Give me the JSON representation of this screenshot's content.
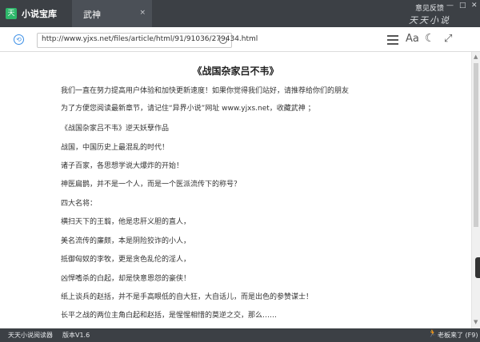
{
  "app": {
    "logo": "天",
    "title": "小说宝库",
    "tab_label": "武神",
    "tab_close": "×",
    "feedback": "意见反馈",
    "brand": "天天小说",
    "minimize": "—",
    "maximize": "□",
    "close": "✕"
  },
  "toolbar": {
    "back_icon": "⟲",
    "url": "http://www.yjxs.net/files/article/html/91/91036/279434.html",
    "font_label": "Aa",
    "moon_icon": "☾",
    "fullscreen_icon": "⤢"
  },
  "article": {
    "title": "《战国杂家吕不韦》",
    "paragraphs": [
      "我们一直在努力提高用户体验和加快更新速度！如果你觉得我们站好，请推荐给你们的朋友",
      "为了方便您阅读最新章节，请记住“异界小说”网址 www.yjxs.net，收藏武神 ；",
      "《战国杂家吕不韦》逆天妖孽作品",
      "战国，中国历史上最混乱的时代！",
      "诸子百家，各思想学说大爆炸的开始！",
      "神医扁鹊，并不是一个人，而是一个医派流传下的称号？",
      "四大名将：",
      "横扫天下的王翦，他是忠肝义胆的直人，",
      "美名流传的廉颇，本是阴险狡诈的小人，",
      "抵御匈奴的李牧，更是贪色乱伦的淫人，",
      "凶悍嗜杀的白起，却是快意恩怨的豪侠！",
      "纸上谈兵的赵括，并不是手高眼低的自大狂，大自话儿，而是出色的参赞谋士！",
      "长平之战的两位主角白起和赵括，是惺惺相惜的莫逆之交，那么……"
    ]
  },
  "status": {
    "reader_name": "天天小说阅读器",
    "version": "版本V1.6",
    "boss_key": "老板来了 (F9)",
    "runner_icon": "🏃"
  }
}
